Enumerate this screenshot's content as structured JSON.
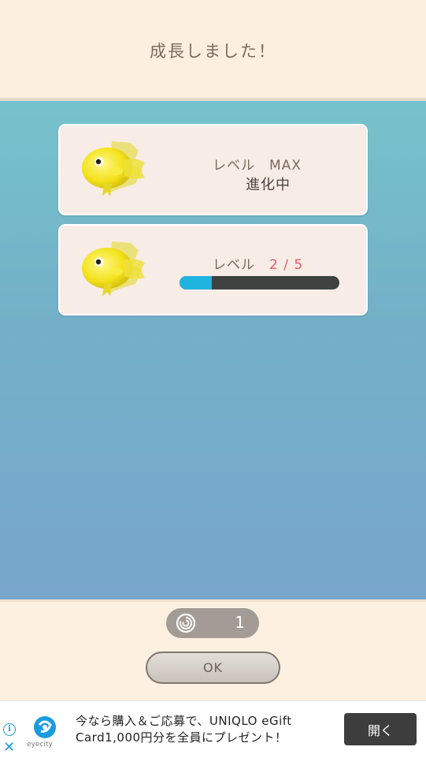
{
  "header": {
    "title": "成長しました！"
  },
  "cards": [
    {
      "level_label": "レベル",
      "level_value": "MAX",
      "status": "進化中"
    },
    {
      "level_label": "レベル",
      "level_value": "2 / 5",
      "progress": 0.2
    }
  ],
  "currency": {
    "icon": "shell-icon",
    "count": "1"
  },
  "ok_button": {
    "label": "OK"
  },
  "ad": {
    "logo_text": "eyecity",
    "text": "今なら購入＆ご応募で、UNIQLO eGift Card1,000円分を全員にプレゼント！",
    "button_label": "開く"
  },
  "colors": {
    "header_bg": "#fdefdf",
    "sea_top": "#76c2cc",
    "sea_bottom": "#78a6cc",
    "card_bg": "#f8ece6",
    "level_red": "#e25b63",
    "progress_fill": "#1fb3e0",
    "progress_track": "#3e4240"
  }
}
